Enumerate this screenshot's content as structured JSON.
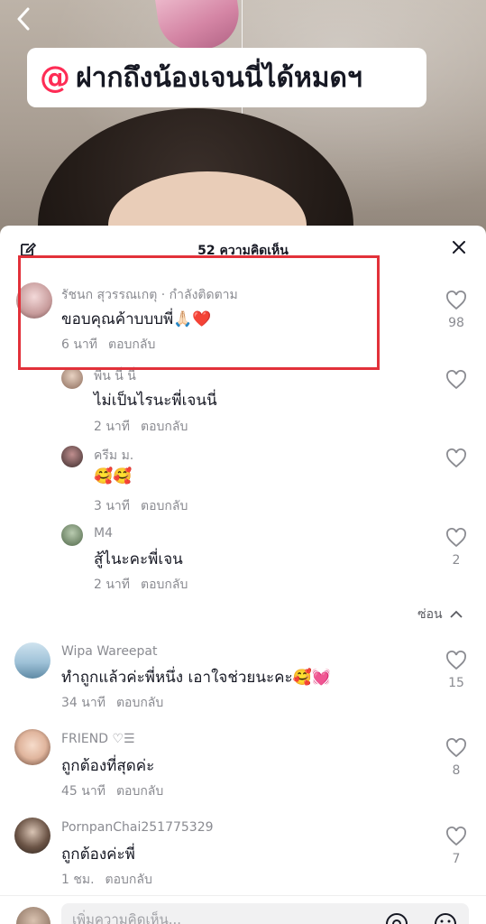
{
  "video": {
    "back_icon": "chevron-left-icon",
    "caption_at": "@",
    "caption_text": "ฝากถึงน้องเจนนี่ได้หมดฯ"
  },
  "sheet": {
    "title": "52 ความคิดเห็น",
    "edit_icon": "edit-icon",
    "close_icon": "close-icon"
  },
  "comments": [
    {
      "name": "รัชนก สุวรรณเกตุ · กำลังติดตาม",
      "text": "ขอบคุณค้าบบบพี่🙏🏻❤️",
      "time": "6 นาที",
      "reply": "ตอบกลับ",
      "likes": "98"
    },
    {
      "name": "พีน นี่ นี่",
      "text": "ไม่เป็นไรนะพี่เจนนี่",
      "time": "2 นาที",
      "reply": "ตอบกลับ",
      "likes": ""
    },
    {
      "name": "ครีม ม.",
      "text": "🥰🥰",
      "time": "3 นาที",
      "reply": "ตอบกลับ",
      "likes": ""
    },
    {
      "name": "M4",
      "text": "สู้ไนะคะพี่เจน",
      "time": "2 นาที",
      "reply": "ตอบกลับ",
      "likes": "2"
    },
    {
      "name": "Wipa Wareepat",
      "text": "ทำถูกแล้วค่ะพี่หนึ่ง เอาใจช่วยนะคะ🥰💓",
      "time": "34 นาที",
      "reply": "ตอบกลับ",
      "likes": "15"
    },
    {
      "name": "FRIEND ♡☰",
      "text": "ถูกต้องที่สุดค่ะ",
      "time": "45 นาที",
      "reply": "ตอบกลับ",
      "likes": "8"
    },
    {
      "name": "PornpanChai251775329",
      "text": "ถูกต้องค่ะพี่",
      "time": "1 ชม.",
      "reply": "ตอบกลับ",
      "likes": "7"
    }
  ],
  "hide_replies": "ซ่อน",
  "input": {
    "placeholder": "เพิ่มความคิดเห็น...",
    "at_icon": "at-icon",
    "emoji_icon": "emoji-icon"
  },
  "colors": {
    "accent": "#fe2c55",
    "highlight_box": "#e2313a",
    "text_primary": "#161823",
    "text_secondary": "#8a8b91"
  }
}
